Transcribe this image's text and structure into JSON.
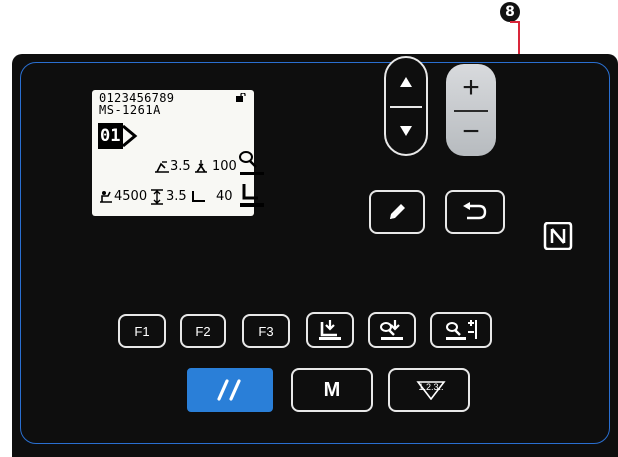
{
  "callout": {
    "number": "8"
  },
  "lcd": {
    "line1": "0123456789",
    "line2": "MS-1261A",
    "pattern_number": "01",
    "thread_tension_value": "3.5",
    "presser_count": "100",
    "speed_value": "4500",
    "stitch_length_value": "3.5",
    "feed_value": "40"
  },
  "keys": {
    "plus_label": "+",
    "minus_label": "−",
    "f1_label": "F1",
    "f2_label": "F2",
    "f3_label": "F3",
    "m_label": "M",
    "counter_label": "1.2.3.."
  },
  "icons": {
    "up": "arrow-up-icon",
    "down": "arrow-down-icon",
    "edit": "pencil-icon",
    "return": "return-icon",
    "reset": "double-slash-icon",
    "nfc": "nfc-icon"
  },
  "colors": {
    "panel": "#0e0e0e",
    "accent_blue": "#2a7fd8",
    "border": "#e8e8e8",
    "lcd": "#f8f8f4"
  }
}
